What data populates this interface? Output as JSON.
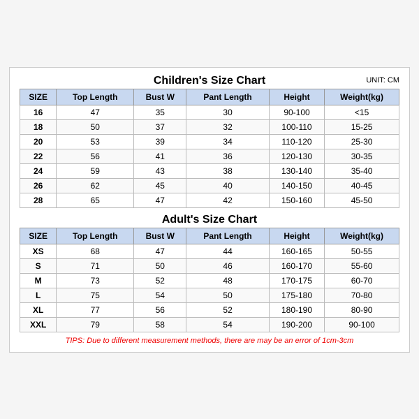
{
  "title": "Children's Size Chart",
  "unit": "UNIT: CM",
  "children_headers": [
    "SIZE",
    "Top Length",
    "Bust W",
    "Pant Length",
    "Height",
    "Weight(kg)"
  ],
  "children_rows": [
    [
      "16",
      "47",
      "35",
      "30",
      "90-100",
      "<15"
    ],
    [
      "18",
      "50",
      "37",
      "32",
      "100-110",
      "15-25"
    ],
    [
      "20",
      "53",
      "39",
      "34",
      "110-120",
      "25-30"
    ],
    [
      "22",
      "56",
      "41",
      "36",
      "120-130",
      "30-35"
    ],
    [
      "24",
      "59",
      "43",
      "38",
      "130-140",
      "35-40"
    ],
    [
      "26",
      "62",
      "45",
      "40",
      "140-150",
      "40-45"
    ],
    [
      "28",
      "65",
      "47",
      "42",
      "150-160",
      "45-50"
    ]
  ],
  "adult_title": "Adult's Size Chart",
  "adult_headers": [
    "SIZE",
    "Top Length",
    "Bust W",
    "Pant Length",
    "Height",
    "Weight(kg)"
  ],
  "adult_rows": [
    [
      "XS",
      "68",
      "47",
      "44",
      "160-165",
      "50-55"
    ],
    [
      "S",
      "71",
      "50",
      "46",
      "160-170",
      "55-60"
    ],
    [
      "M",
      "73",
      "52",
      "48",
      "170-175",
      "60-70"
    ],
    [
      "L",
      "75",
      "54",
      "50",
      "175-180",
      "70-80"
    ],
    [
      "XL",
      "77",
      "56",
      "52",
      "180-190",
      "80-90"
    ],
    [
      "XXL",
      "79",
      "58",
      "54",
      "190-200",
      "90-100"
    ]
  ],
  "tips": "TIPS: Due to different measurement methods, there are may be an error of 1cm-3cm"
}
